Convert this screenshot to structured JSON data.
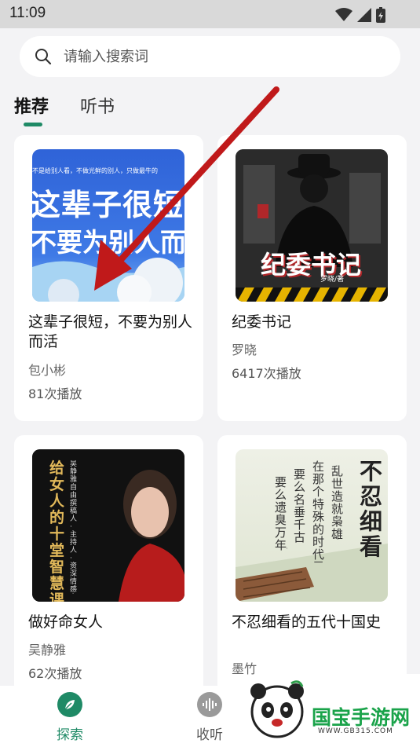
{
  "status_bar": {
    "time": "11:09"
  },
  "search": {
    "placeholder": "请输入搜索词"
  },
  "tabs": [
    {
      "label": "推荐",
      "active": true
    },
    {
      "label": "听书",
      "active": false
    }
  ],
  "books": [
    {
      "title": "这辈子很短，不要为别人而活",
      "author": "包小彬",
      "plays": "81次播放",
      "cover_top_text": "不是给别人看，不做光鲜的别人，只做最牛的",
      "cover_line1": "这辈子很短",
      "cover_line2": "不要为别人而"
    },
    {
      "title": "纪委书记",
      "author": "罗晓",
      "plays": "6417次播放",
      "cover_main": "纪委书记",
      "cover_author": "罗晓/著"
    },
    {
      "title": "做好命女人",
      "author": "吴静雅",
      "plays": "62次播放",
      "cover_main": "给女人的十堂智慧课",
      "cover_sub": "吴静雅 自由撰稿人·主持人·资深情感专家"
    },
    {
      "title": "不忍细看的五代十国史",
      "author": "墨竹",
      "plays": "",
      "cover_main": "不忍细看",
      "cover_poem_1": "乱世造就枭雄，",
      "cover_poem_2": "在那个特殊的时代里，",
      "cover_poem_3": "要么名垂千古，",
      "cover_poem_4": "要么遗臭万年。"
    }
  ],
  "bottom_nav": [
    {
      "label": "探索",
      "active": true,
      "icon": "compass-leaf-icon"
    },
    {
      "label": "收听",
      "active": false,
      "icon": "audio-wave-icon"
    }
  ],
  "watermark": {
    "brand": "国宝手游网",
    "url": "WWW.GB315.COM"
  },
  "colors": {
    "accent": "#1f8a66",
    "arrow": "#c0191a"
  }
}
